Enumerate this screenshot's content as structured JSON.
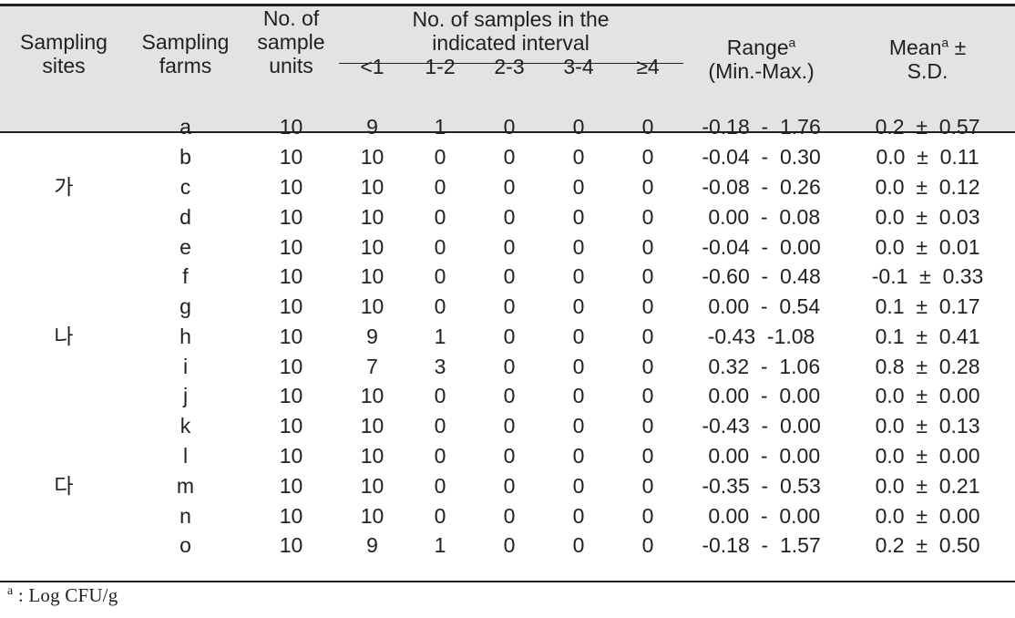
{
  "table": {
    "header": {
      "col_sampling_sites": "Sampling\nsites",
      "col_sampling_farms": "Sampling\nfarms",
      "col_sample_units": "No. of\nsample\nunits",
      "span_intervals": "No. of  samples  in  the\nindicated  interval",
      "interval_bins": [
        "<1",
        "1-2",
        "2-3",
        "3-4",
        "≥4"
      ],
      "col_range_line1": "Range",
      "col_range_sup": "a",
      "col_range_line2": "(Min.-Max.)",
      "col_mean_line1": "Mean",
      "col_mean_sup": "a",
      "col_mean_pm": " ±",
      "col_mean_line2": "S.D."
    },
    "sites": [
      {
        "label": "가",
        "row_span": 6,
        "center_row_index": 2
      },
      {
        "label": "나",
        "row_span": 6,
        "center_row_index": 1
      },
      {
        "label": "다",
        "row_span": 3,
        "center_row_index": 0
      }
    ],
    "rows": [
      {
        "site": "가",
        "farm": "a",
        "units": "10",
        "b1": "9",
        "b2": "1",
        "b3": "0",
        "b4": "0",
        "b5": "0",
        "range": "-0.18  -  1.76",
        "mean": "0.2  ±  0.57"
      },
      {
        "site": "",
        "farm": "b",
        "units": "10",
        "b1": "10",
        "b2": "0",
        "b3": "0",
        "b4": "0",
        "b5": "0",
        "range": "-0.04  -  0.30",
        "mean": "0.0  ±  0.11"
      },
      {
        "site": "",
        "farm": "c",
        "units": "10",
        "b1": "10",
        "b2": "0",
        "b3": "0",
        "b4": "0",
        "b5": "0",
        "range": "-0.08  -  0.26",
        "mean": "0.0  ±  0.12"
      },
      {
        "site": "",
        "farm": "d",
        "units": "10",
        "b1": "10",
        "b2": "0",
        "b3": "0",
        "b4": "0",
        "b5": "0",
        "range": " 0.00  -  0.08",
        "mean": "0.0  ±  0.03"
      },
      {
        "site": "",
        "farm": "e",
        "units": "10",
        "b1": "10",
        "b2": "0",
        "b3": "0",
        "b4": "0",
        "b5": "0",
        "range": "-0.04  -  0.00",
        "mean": "0.0  ±  0.01"
      },
      {
        "site": "",
        "farm": "f",
        "units": "10",
        "b1": "10",
        "b2": "0",
        "b3": "0",
        "b4": "0",
        "b5": "0",
        "range": "-0.60  -  0.48",
        "mean": "-0.1  ±  0.33"
      },
      {
        "site": "",
        "farm": "g",
        "units": "10",
        "b1": "10",
        "b2": "0",
        "b3": "0",
        "b4": "0",
        "b5": "0",
        "range": " 0.00  -  0.54",
        "mean": "0.1  ±  0.17"
      },
      {
        "site": "나",
        "farm": "h",
        "units": "10",
        "b1": "9",
        "b2": "1",
        "b3": "0",
        "b4": "0",
        "b5": "0",
        "range": "-0.43  -1.08",
        "mean": "0.1  ±  0.41"
      },
      {
        "site": "",
        "farm": "i",
        "units": "10",
        "b1": "7",
        "b2": "3",
        "b3": "0",
        "b4": "0",
        "b5": "0",
        "range": " 0.32  -  1.06",
        "mean": "0.8  ±  0.28"
      },
      {
        "site": "",
        "farm": "j",
        "units": "10",
        "b1": "10",
        "b2": "0",
        "b3": "0",
        "b4": "0",
        "b5": "0",
        "range": " 0.00  -  0.00",
        "mean": "0.0  ±  0.00"
      },
      {
        "site": "",
        "farm": "k",
        "units": "10",
        "b1": "10",
        "b2": "0",
        "b3": "0",
        "b4": "0",
        "b5": "0",
        "range": "-0.43  -  0.00",
        "mean": "0.0  ±  0.13"
      },
      {
        "site": "",
        "farm": "l",
        "units": "10",
        "b1": "10",
        "b2": "0",
        "b3": "0",
        "b4": "0",
        "b5": "0",
        "range": " 0.00  -  0.00",
        "mean": "0.0  ±  0.00"
      },
      {
        "site": "다",
        "farm": "m",
        "units": "10",
        "b1": "10",
        "b2": "0",
        "b3": "0",
        "b4": "0",
        "b5": "0",
        "range": "-0.35  -  0.53",
        "mean": "0.0  ±  0.21"
      },
      {
        "site": "",
        "farm": "n",
        "units": "10",
        "b1": "10",
        "b2": "0",
        "b3": "0",
        "b4": "0",
        "b5": "0",
        "range": " 0.00  -  0.00",
        "mean": "0.0  ±  0.00"
      },
      {
        "site": "",
        "farm": "o",
        "units": "10",
        "b1": "9",
        "b2": "1",
        "b3": "0",
        "b4": "0",
        "b5": "0",
        "range": "-0.18  -  1.57",
        "mean": "0.2  ±  0.50"
      }
    ],
    "footnote": {
      "marker": "a",
      "text": " :  Log  CFU/g"
    }
  },
  "colors": {
    "header_background": "#e3e3e3",
    "rule": "#231f20",
    "text": "#231f20",
    "page_background": "#ffffff"
  }
}
